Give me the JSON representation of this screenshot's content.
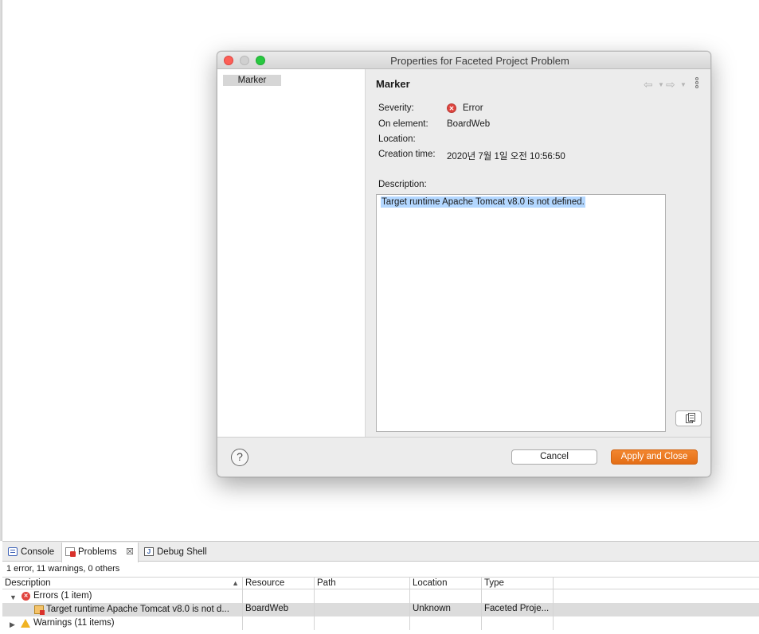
{
  "dialog": {
    "title": "Properties for Faceted Project Problem",
    "nav_items": [
      "Marker"
    ],
    "section_title": "Marker",
    "history_back_icon": "arrow-left-icon",
    "history_forward_icon": "arrow-right-icon",
    "fields": {
      "severity_label": "Severity:",
      "severity_value": "Error",
      "element_label": "On element:",
      "element_value": "BoardWeb",
      "location_label": "Location:",
      "creation_label": "Creation time:",
      "creation_value": "2020년 7월 1일 오전 10:56:50"
    },
    "description_label": "Description:",
    "description_text": "Target runtime Apache Tomcat v8.0 is not defined.",
    "help_label": "?",
    "cancel_label": "Cancel",
    "apply_label": "Apply and Close",
    "accent_color": "#ec7a22"
  },
  "views": {
    "tabs": [
      "Console",
      "Problems",
      "Debug Shell"
    ],
    "active_tab": "Problems",
    "summary": "1 error, 11 warnings, 0 others",
    "columns": [
      "Description",
      "Resource",
      "Path",
      "Location",
      "Type"
    ],
    "rows": [
      {
        "kind": "group",
        "label": "Errors (1 item)"
      },
      {
        "kind": "item",
        "description": "Target runtime Apache Tomcat v8.0 is not d...",
        "resource": "BoardWeb",
        "path": "",
        "location": "Unknown",
        "type": "Faceted Proje..."
      },
      {
        "kind": "group",
        "label": "Warnings (11 items)"
      }
    ]
  }
}
